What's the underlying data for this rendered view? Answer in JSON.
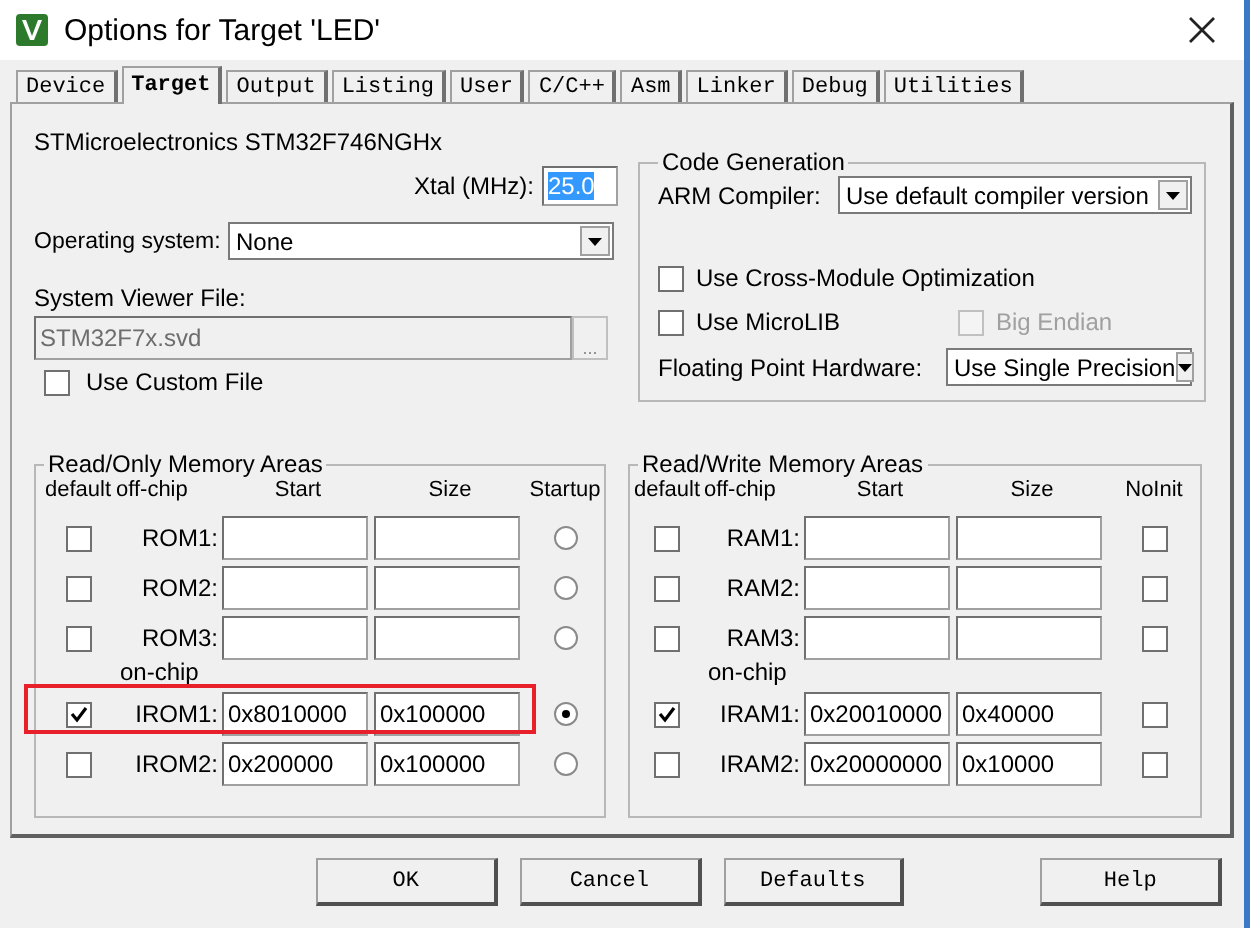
{
  "window": {
    "title": "Options for Target 'LED'"
  },
  "tabs": [
    {
      "label": "Device",
      "selected": false
    },
    {
      "label": "Target",
      "selected": true
    },
    {
      "label": "Output",
      "selected": false
    },
    {
      "label": "Listing",
      "selected": false
    },
    {
      "label": "User",
      "selected": false
    },
    {
      "label": "C/C++",
      "selected": false
    },
    {
      "label": "Asm",
      "selected": false
    },
    {
      "label": "Linker",
      "selected": false
    },
    {
      "label": "Debug",
      "selected": false
    },
    {
      "label": "Utilities",
      "selected": false
    }
  ],
  "device": "STMicroelectronics STM32F746NGHx",
  "xtal": {
    "label": "Xtal (MHz):",
    "value": "25.0",
    "text_selected": true
  },
  "os": {
    "label": "Operating system:",
    "value": "None"
  },
  "svd": {
    "label": "System Viewer File:",
    "value": "STM32F7x.svd",
    "disabled": true,
    "browse": "..."
  },
  "custom_file": {
    "label": "Use Custom File",
    "checked": false
  },
  "code_generation": {
    "title": "Code Generation",
    "compiler_label": "ARM Compiler:",
    "compiler": "Use default compiler version",
    "options": [
      {
        "label": "Use Cross-Module Optimization",
        "checked": false,
        "disabled": false
      },
      {
        "label": "Use MicroLIB",
        "checked": false,
        "disabled": false
      },
      {
        "label": "Big Endian",
        "checked": false,
        "disabled": true
      }
    ],
    "fpu_label": "Floating Point Hardware:",
    "fpu": "Use Single Precision"
  },
  "rom": {
    "title": "Read/Only Memory Areas",
    "columns": [
      "default",
      "off-chip",
      "Start",
      "Size",
      "Startup"
    ],
    "on_chip_label": "on-chip",
    "off_chip_rows": [
      {
        "name": "ROM1:",
        "default": false,
        "selected": false,
        "highlighted": false
      },
      {
        "name": "ROM2:",
        "default": false,
        "selected": false,
        "highlighted": false
      },
      {
        "name": "ROM3:",
        "default": false,
        "selected": false,
        "highlighted": false
      }
    ],
    "on_chip_rows": [
      {
        "name": "IROM1:",
        "default": true,
        "start": "0x8010000",
        "size": "0x100000",
        "selected": true,
        "highlighted": true
      },
      {
        "name": "IROM2:",
        "default": false,
        "start": "0x200000",
        "size": "0x100000",
        "selected": false,
        "highlighted": false
      }
    ]
  },
  "ram": {
    "title": "Read/Write Memory Areas",
    "columns": [
      "default",
      "off-chip",
      "Start",
      "Size",
      "NoInit"
    ],
    "on_chip_label": "on-chip",
    "off_chip_rows": [
      {
        "name": "RAM1:",
        "default": false,
        "noinit": false
      },
      {
        "name": "RAM2:",
        "default": false,
        "noinit": false
      },
      {
        "name": "RAM3:",
        "default": false,
        "noinit": false
      }
    ],
    "on_chip_rows": [
      {
        "name": "IRAM1:",
        "default": true,
        "start": "0x20010000",
        "size": "0x40000",
        "noinit": false
      },
      {
        "name": "IRAM2:",
        "default": false,
        "start": "0x20000000",
        "size": "0x10000",
        "noinit": false
      }
    ]
  },
  "buttons": [
    "OK",
    "Cancel",
    "Defaults",
    "Help"
  ]
}
